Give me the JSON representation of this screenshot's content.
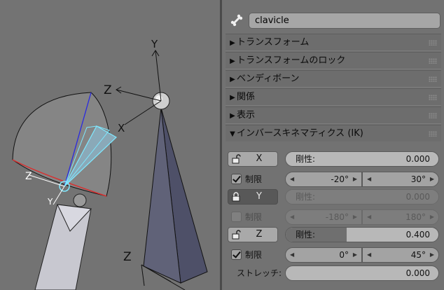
{
  "viewport": {
    "axis_labels": {
      "top_y": "Y",
      "top_z": "Z",
      "top_x": "X",
      "left_z": "Z",
      "left_y": "Y",
      "bottom_z": "Z"
    }
  },
  "header": {
    "bone_icon": "bone-icon",
    "bone_name": "clavicle"
  },
  "sections": [
    {
      "label": "トランスフォーム",
      "expanded": false
    },
    {
      "label": "トランスフォームのロック",
      "expanded": false
    },
    {
      "label": "ベンディボーン",
      "expanded": false
    },
    {
      "label": "関係",
      "expanded": false
    },
    {
      "label": "表示",
      "expanded": false
    },
    {
      "label": "インバースキネマティクス (IK)",
      "expanded": true
    }
  ],
  "ik": {
    "x": {
      "axis": "X",
      "locked": false,
      "stiffness_label": "剛性:",
      "stiffness": "0.000",
      "limit_label": "制限",
      "limit_enabled": true,
      "min": "-20°",
      "max": "30°"
    },
    "y": {
      "axis": "Y",
      "locked": true,
      "stiffness_label": "剛性:",
      "stiffness": "0.000",
      "limit_label": "制限",
      "limit_enabled": false,
      "min": "-180°",
      "max": "180°"
    },
    "z": {
      "axis": "Z",
      "locked": false,
      "stiffness_label": "剛性:",
      "stiffness": "0.400",
      "stiffness_fraction": 0.4,
      "limit_label": "制限",
      "limit_enabled": true,
      "min": "0°",
      "max": "45°"
    },
    "stretch_label": "ストレッチ:",
    "stretch": "0.000"
  },
  "colors": {
    "viewport_bg": "#737373",
    "panel_bg": "#727272",
    "limit_red": "#d83030",
    "axis_blue": "#2a2ae0",
    "ik_cyan": "#7fe8ff"
  }
}
